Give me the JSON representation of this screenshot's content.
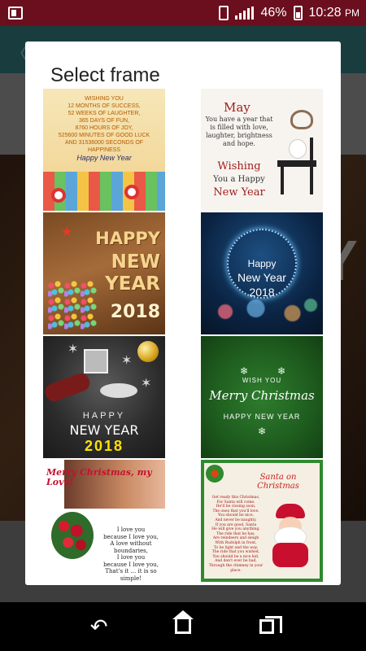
{
  "status_bar": {
    "battery_percent": "46%",
    "time": "10:28",
    "ampm": "PM"
  },
  "dialog": {
    "title": "Select frame"
  },
  "frames": [
    {
      "id_label": "frame-wishing",
      "lines": [
        "WISHING YOU",
        "12 MONTHS OF SUCCESS,",
        "52 WEEKS OF LAUGHTER,",
        "365 DAYS OF FUN,",
        "8760 HOURS OF JOY,",
        "525600 MINUTES OF GOOD LUCK",
        "AND 31536000 SECONDS OF HAPPINESS"
      ],
      "script": "Happy New Year"
    },
    {
      "id_label": "frame-may",
      "heading": "May",
      "body": "You have a year that is filled with love, laughter, brightness and hope.",
      "wishing": "Wishing",
      "you_a_happy": "You a Happy",
      "new_year": "New Year"
    },
    {
      "id_label": "frame-wood-2018",
      "line1": "HAPPY",
      "line2": "NEW",
      "line3": "YEAR",
      "year": "2018"
    },
    {
      "id_label": "frame-bokeh-2018",
      "line1": "Happy",
      "line2": "New Year",
      "year": "2018"
    },
    {
      "id_label": "frame-dark-2018",
      "happy": "HAPPY",
      "new_year": "NEW YEAR",
      "year": "2018"
    },
    {
      "id_label": "frame-merry-christmas-green",
      "wish_you": "WISH YOU",
      "merry_christmas": "Merry Christmas",
      "happy_new_year": "HAPPY NEW YEAR"
    },
    {
      "id_label": "frame-love",
      "title": "Merry Christmas, my Love!",
      "poem": [
        "I love you",
        "because I love you,",
        "A love without",
        "boundaries,",
        "I love you",
        "because I love you,",
        "That's it ... it is so simple!"
      ]
    },
    {
      "id_label": "frame-santa",
      "title": "Santa on Christmas",
      "poem": [
        "Get ready this Christmas,",
        "For Santa will come.",
        "He'll be closing soon,",
        "The ones that you'll love.",
        "You should be nice,",
        "And never be naughty.",
        "If you are good, Santa",
        "He will give you anything.",
        "The ride that he has,",
        "Are reindeers and sleigh",
        "With Rudolph in front,",
        "To be light and the way.",
        "The ride that you wished,",
        "You should be a nice kid,",
        "And don't ever be bad,",
        "Through the chimney in your place."
      ]
    }
  ],
  "background": {
    "big_letter": "Y"
  },
  "colors": {
    "status_bar": "#6b0f1f",
    "app_bar": "#2f6d72",
    "dialog_bg": "#ffffff",
    "nav_bar": "#000000"
  },
  "icons": {
    "status_left": "screenshot-icon",
    "vibrate": "vibrate-icon",
    "signal": "signal-icon",
    "battery": "battery-icon",
    "nav_back": "back-icon",
    "nav_home": "home-icon",
    "nav_recent": "recent-apps-icon"
  }
}
